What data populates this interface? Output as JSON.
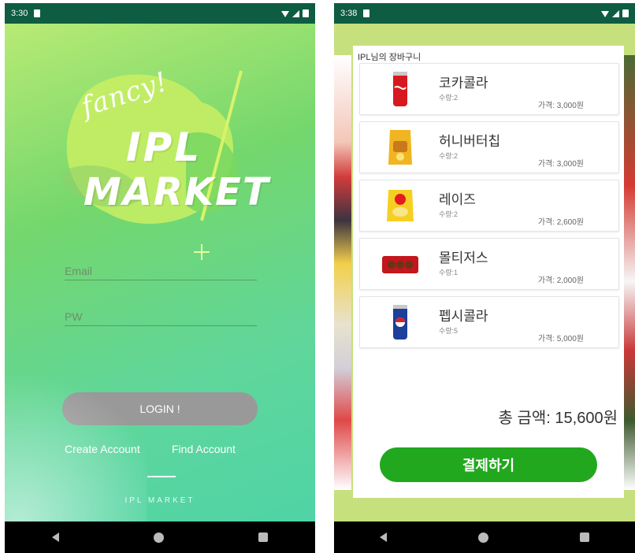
{
  "left_status": {
    "time": "3:30"
  },
  "right_status": {
    "time": "3:38"
  },
  "login": {
    "fancy_text": "fancy!",
    "brand_line1": "IPL",
    "brand_line2": "MARKET",
    "email_placeholder": "Email",
    "pw_placeholder": "PW",
    "login_label": "LOGIN !",
    "create_account": "Create Account",
    "find_account": "Find Account",
    "footer": "IPL MARKET"
  },
  "cart": {
    "title": "IPL님의 장바구니",
    "items": [
      {
        "name": "코카콜라",
        "qty": "수량:2",
        "price": "가격: 3,000원",
        "icon": "cola-can-icon"
      },
      {
        "name": "허니버터칩",
        "qty": "수량:2",
        "price": "가격: 3,000원",
        "icon": "chips-bag-icon"
      },
      {
        "name": "레이즈",
        "qty": "수량:2",
        "price": "가격: 2,600원",
        "icon": "chips-bag-icon"
      },
      {
        "name": "몰티저스",
        "qty": "수량:1",
        "price": "가격: 2,000원",
        "icon": "candy-pack-icon"
      },
      {
        "name": "펩시콜라",
        "qty": "수량:5",
        "price": "가격: 5,000원",
        "icon": "pepsi-can-icon"
      }
    ],
    "total": "총 금액: 15,600원",
    "pay_label": "결제하기"
  },
  "colors": {
    "status_bar": "#0e5c41",
    "login_button": "#999999",
    "pay_button": "#22a81f",
    "cart_bg": "#c6e07d"
  }
}
